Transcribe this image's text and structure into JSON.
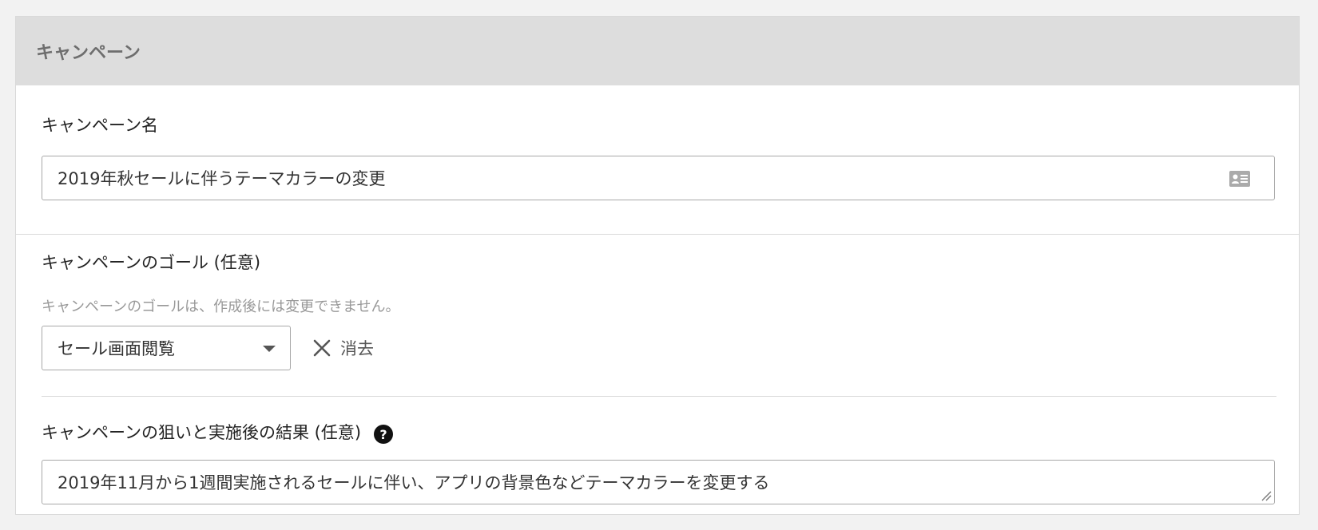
{
  "panel": {
    "title": "キャンペーン"
  },
  "name_field": {
    "label": "キャンペーン名",
    "value": "2019年秋セールに伴うテーマカラーの変更",
    "icon": "contact-card-icon"
  },
  "goal_field": {
    "label": "キャンペーンのゴール (任意)",
    "hint": "キャンペーンのゴールは、作成後には変更できません。",
    "selected": "セール画面閲覧",
    "clear_label": "消去"
  },
  "aim_field": {
    "label": "キャンペーンの狙いと実施後の結果 (任意)",
    "help_glyph": "?",
    "value": "2019年11月から1週間実施されるセールに伴い、アプリの背景色などテーマカラーを変更する"
  }
}
